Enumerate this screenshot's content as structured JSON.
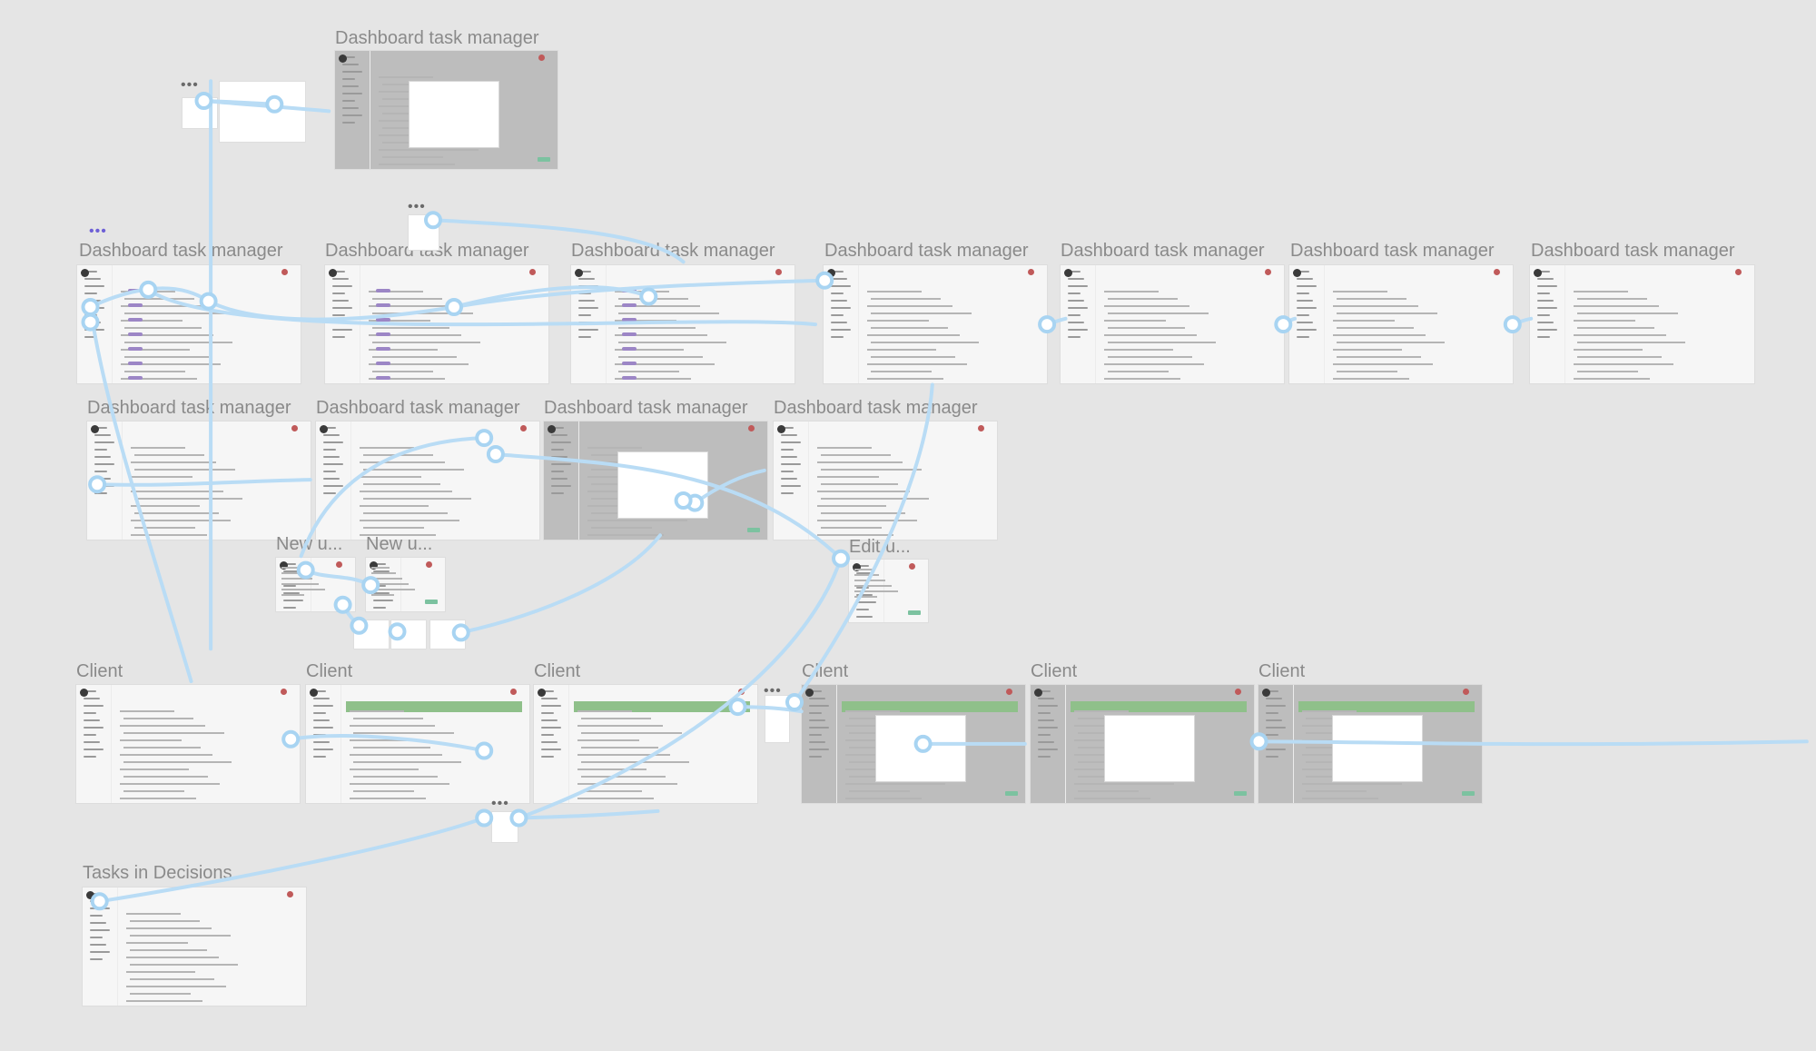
{
  "canvas": {
    "background": "#e5e5e5",
    "connector_color": "#b9dcf5",
    "connector_stroke_color": "#a8d4f2"
  },
  "frames": [
    {
      "label": "Dashboard task manager",
      "variant": "dimmed-modal"
    },
    {
      "label": "Dashboard task manager",
      "variant": "task-list"
    },
    {
      "label": "Dashboard task manager",
      "variant": "task-list"
    },
    {
      "label": "Dashboard task manager",
      "variant": "task-list"
    },
    {
      "label": "Dashboard task manager",
      "variant": "dashboard"
    },
    {
      "label": "Dashboard task manager",
      "variant": "dashboard"
    },
    {
      "label": "Dashboard task manager",
      "variant": "dashboard"
    },
    {
      "label": "Dashboard task manager",
      "variant": "dashboard"
    },
    {
      "label": "Dashboard task manager",
      "variant": "table"
    },
    {
      "label": "Dashboard task manager",
      "variant": "user-groups"
    },
    {
      "label": "Dashboard task manager",
      "variant": "dimmed-modal"
    },
    {
      "label": "Dashboard task manager",
      "variant": "user-groups"
    },
    {
      "label": "New u...",
      "variant": "dialog"
    },
    {
      "label": "New u...",
      "variant": "dialog"
    },
    {
      "label": "Edit u...",
      "variant": "dialog"
    },
    {
      "label": "Client",
      "variant": "table"
    },
    {
      "label": "Client",
      "variant": "client-detail"
    },
    {
      "label": "Client",
      "variant": "client-detail"
    },
    {
      "label": "Client",
      "variant": "client-modal"
    },
    {
      "label": "Client",
      "variant": "client-modal"
    },
    {
      "label": "Client",
      "variant": "client-modal"
    },
    {
      "label": "Tasks in Decisions",
      "variant": "kanban"
    }
  ],
  "floating": {
    "overflow_menu_glyph": "•••"
  }
}
